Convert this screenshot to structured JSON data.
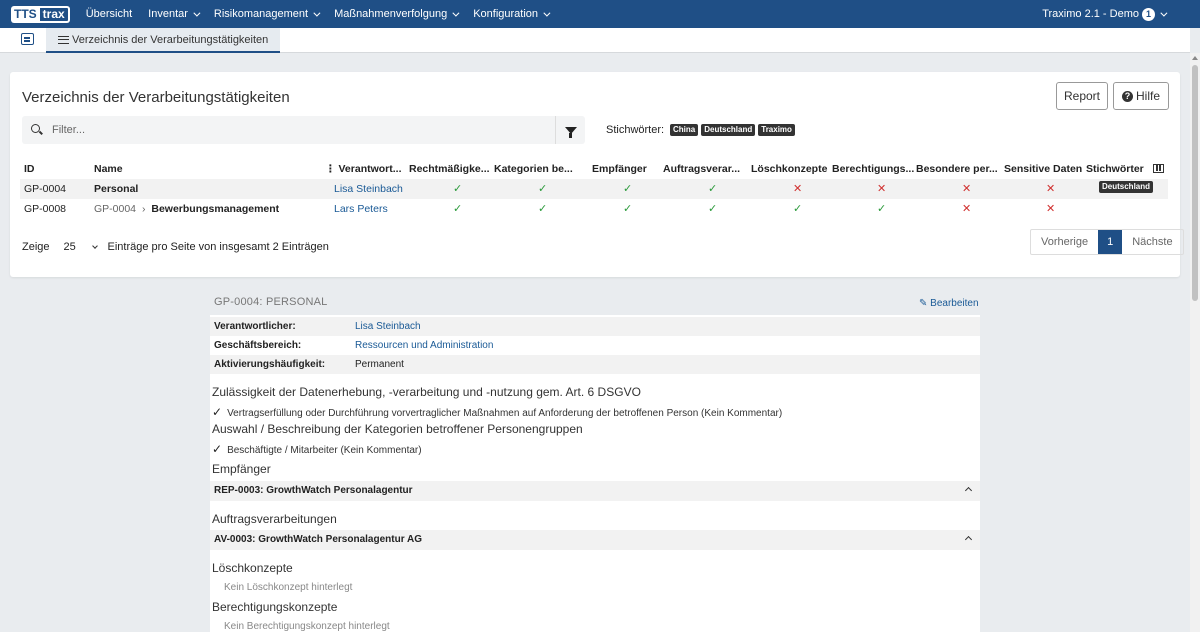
{
  "app": {
    "logo_left": "TTS",
    "logo_right": "trax",
    "nav": [
      "Übersicht",
      "Inventar",
      "Risikomanagement",
      "Maßnahmenverfolgung",
      "Konfiguration"
    ],
    "user_label": "Traximo 2.1 - Demo",
    "user_badge": "1"
  },
  "tabs": {
    "active": "Verzeichnis der Verarbeitungstätigkeiten"
  },
  "card": {
    "title": "Verzeichnis der Verarbeitungstätigkeiten",
    "report_label": "Report",
    "help_label": "Hilfe",
    "filter_placeholder": "Filter...",
    "keywords_label": "Stichwörter:",
    "keywords": [
      "China",
      "Deutschland",
      "Traximo"
    ]
  },
  "table": {
    "headers": [
      "ID",
      "Name",
      "Verantwort...",
      "Rechtmäßigke...",
      "Kategorien be...",
      "Empfänger",
      "Auftragsverar...",
      "Löschkonzepte",
      "Berechtigungs...",
      "Besondere per...",
      "Sensitive Daten",
      "Stichwörter"
    ],
    "rows": [
      {
        "id": "GP-0004",
        "parent": "",
        "name": "Personal",
        "responsible": "Lisa Steinbach",
        "flags": [
          true,
          true,
          true,
          true,
          false,
          false,
          false,
          false
        ],
        "tag": "Deutschland"
      },
      {
        "id": "GP-0008",
        "parent": "GP-0004",
        "name": "Bewerbungsmanagement",
        "responsible": "Lars Peters",
        "flags": [
          true,
          true,
          true,
          true,
          true,
          true,
          false,
          false
        ],
        "tag": ""
      }
    ],
    "show_label": "Zeige",
    "page_size": "25",
    "entries_label": "Einträge pro Seite von insgesamt 2 Einträgen",
    "prev_label": "Vorherige",
    "page": "1",
    "next_label": "Nächste"
  },
  "detail": {
    "title": "GP-0004: PERSONAL",
    "edit_label": "Bearbeiten",
    "fields": [
      {
        "key": "Verantwortlicher:",
        "value": "Lisa Steinbach"
      },
      {
        "key": "Geschäftsbereich:",
        "value": "Ressourcen und Administration"
      },
      {
        "key": "Aktivierungshäufigkeit:",
        "value": "Permanent"
      }
    ],
    "sec_legal": "Zulässigkeit der Datenerhebung, -verarbeitung und -nutzung gem. Art. 6 DSGVO",
    "legal_item": "Vertragserfüllung oder Durchführung vorvertraglicher Maßnahmen auf Anforderung der betroffenen Person (Kein Kommentar)",
    "sec_categories": "Auswahl / Beschreibung der Kategorien betroffener Personengruppen",
    "category_item": "Beschäftigte / Mitarbeiter (Kein Kommentar)",
    "sec_recipients": "Empfänger",
    "recipient_panel": "REP-0003: GrowthWatch Personalagentur",
    "sec_processing": "Auftragsverarbeitungen",
    "processing_panel": "AV-0003: GrowthWatch Personalagentur AG",
    "sec_deletion": "Löschkonzepte",
    "deletion_empty": "Kein Löschkonzept hinterlegt",
    "sec_permission": "Berechtigungskonzepte",
    "permission_empty": "Kein Berechtigungskonzept hinterlegt"
  },
  "colors": {
    "nav": "#1f4f86",
    "check": "#2a9a3a",
    "cross": "#d0302f",
    "link": "#1a5a96"
  }
}
